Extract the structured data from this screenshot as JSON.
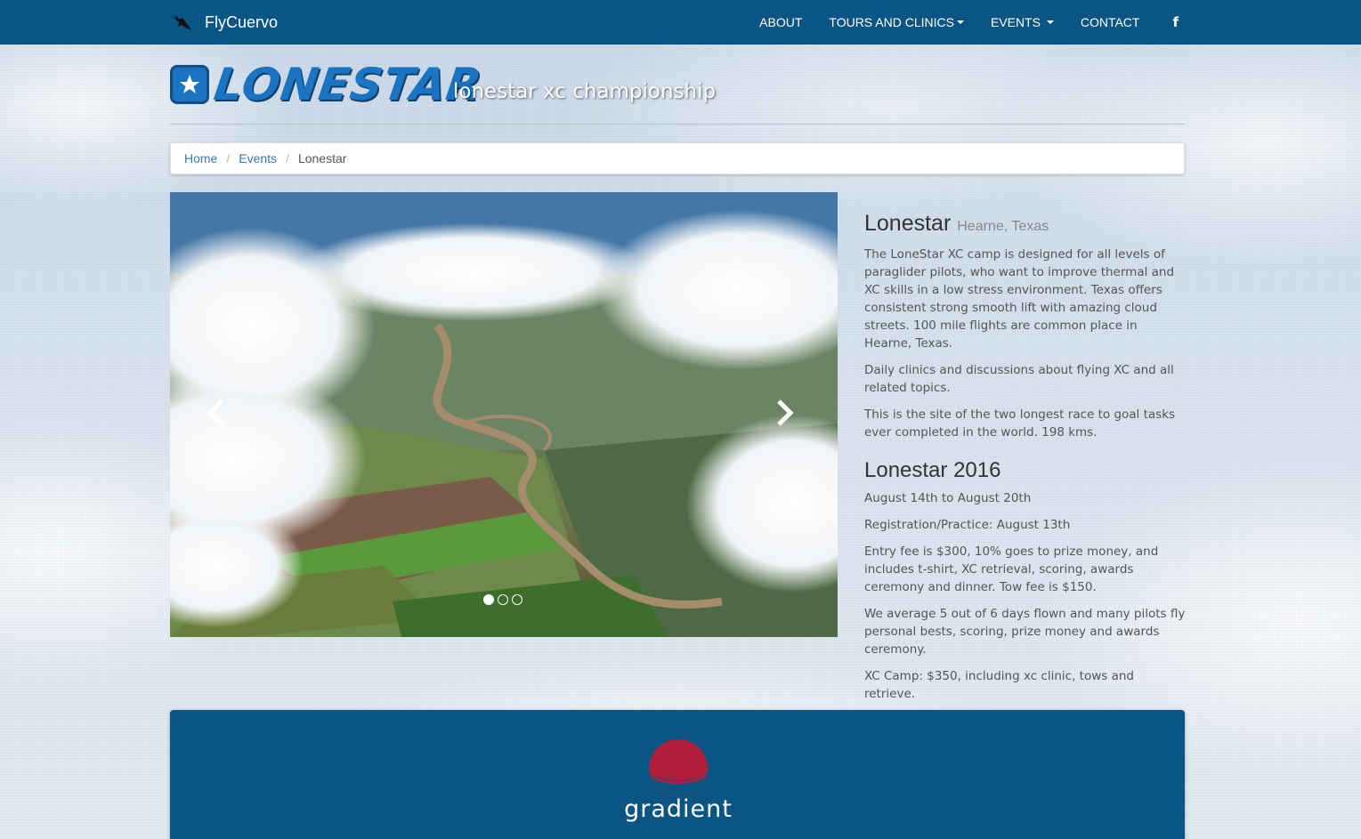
{
  "navbar": {
    "brand": "FlyCuervo",
    "brand_icon": "bird-icon",
    "items": [
      {
        "label": "ABOUT"
      },
      {
        "label": "TOURS AND CLINICS",
        "dropdown": true
      },
      {
        "label": "EVENTS",
        "dropdown": true
      },
      {
        "label": "CONTACT"
      }
    ],
    "social_icon": "facebook-icon",
    "social_label": "f"
  },
  "header": {
    "logo_text": "LONESTAR",
    "logo_icon": "star-icon",
    "subtitle": "lonestar xc championship"
  },
  "breadcrumb": {
    "items": [
      "Home",
      "Events"
    ],
    "active": "Lonestar"
  },
  "carousel": {
    "slide_count": 3,
    "active_index": 0,
    "prev_icon": "chevron-left-icon",
    "next_icon": "chevron-right-icon"
  },
  "content": {
    "title": "Lonestar",
    "location": "Hearne, Texas",
    "intro": [
      "The LoneStar XC camp is designed for all levels of paraglider pilots, who want to improve thermal and XC skills in a low stress environment. Texas offers consistent strong smooth lift with amazing cloud streets. 100 mile flights are common place in Hearne, Texas.",
      "Daily clinics and discussions about flying XC and all related topics.",
      "This is the site of the two longest race to goal tasks ever completed in the world. 198 kms."
    ],
    "event_title": "Lonestar 2016",
    "event_details": [
      "August 14th to August 20th",
      "Registration/Practice: August 13th",
      "Entry fee is $300, 10% goes to prize money, and includes t-shirt, XC retrieval, scoring, awards ceremony and dinner. Tow fee is $150.",
      "We average 5 out of 6 days flown and many pilots fly personal bests, scoring, prize money and awards ceremony.",
      "XC Camp: $350, including xc clinic, tows and retrieve."
    ]
  },
  "sponsor": {
    "name": "gradient",
    "logo_icon": "gradient-logo-icon"
  },
  "colors": {
    "nav_bg": "#0b5584",
    "link": "#3579b6",
    "logo_blue": "#1b74c1",
    "sponsor_red": "#b0203a"
  }
}
